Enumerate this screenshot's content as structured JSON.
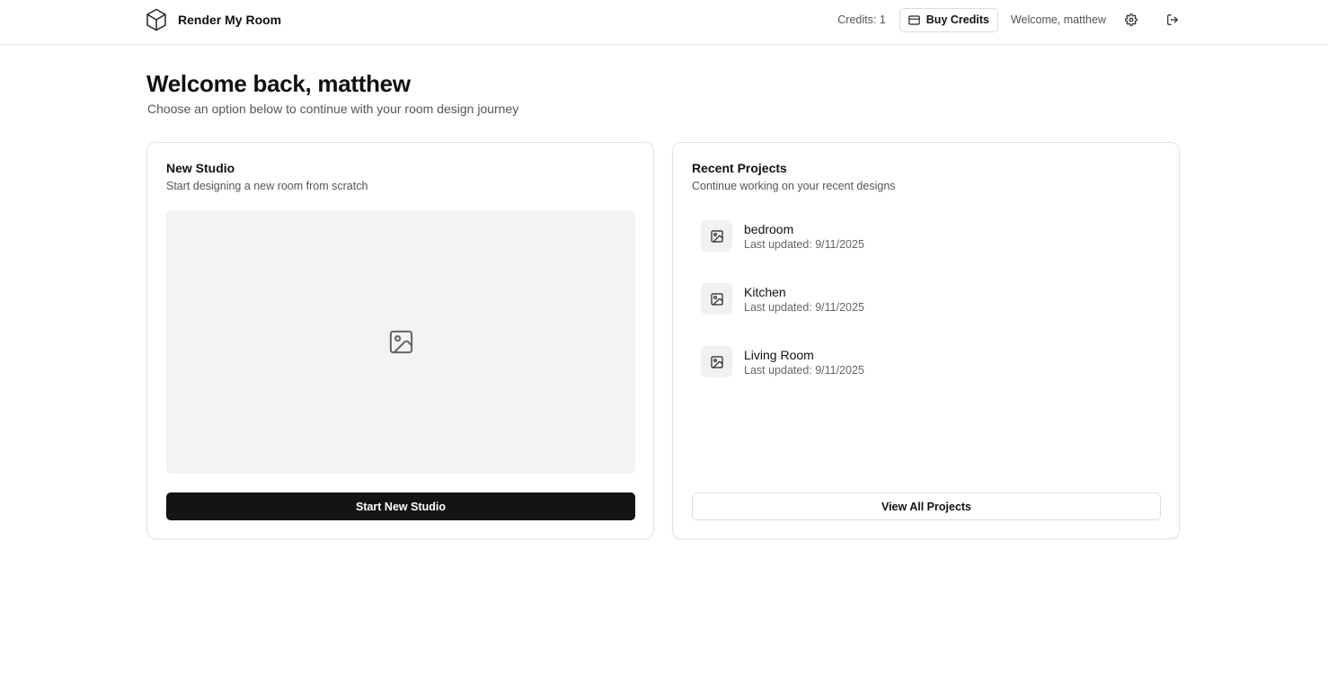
{
  "header": {
    "app_name": "Render My Room",
    "logo_icon": "cube-icon",
    "credits_text": "Credits: 1",
    "buy_credits_label": "Buy Credits",
    "buy_credits_icon": "credit-card-icon",
    "welcome_text": "Welcome, matthew",
    "settings_icon": "gear-icon",
    "logout_icon": "logout-icon"
  },
  "main": {
    "title": "Welcome back, matthew",
    "subtitle": "Choose an option below to continue with your room design journey"
  },
  "new_studio": {
    "title": "New Studio",
    "description": "Start designing a new room from scratch",
    "preview_icon": "image-placeholder-icon",
    "button_label": "Start New Studio"
  },
  "recent_projects": {
    "title": "Recent Projects",
    "description": "Continue working on your recent designs",
    "items": [
      {
        "name": "bedroom",
        "updated": "Last updated: 9/11/2025",
        "icon": "image-icon"
      },
      {
        "name": "Kitchen",
        "updated": "Last updated: 9/11/2025",
        "icon": "image-icon"
      },
      {
        "name": "Living Room",
        "updated": "Last updated: 9/11/2025",
        "icon": "image-icon"
      }
    ],
    "button_label": "View All Projects"
  },
  "colors": {
    "primary_button": "#141414",
    "border": "#e3e3e3",
    "muted_text": "#555555",
    "placeholder_bg": "#f3f3f3"
  }
}
